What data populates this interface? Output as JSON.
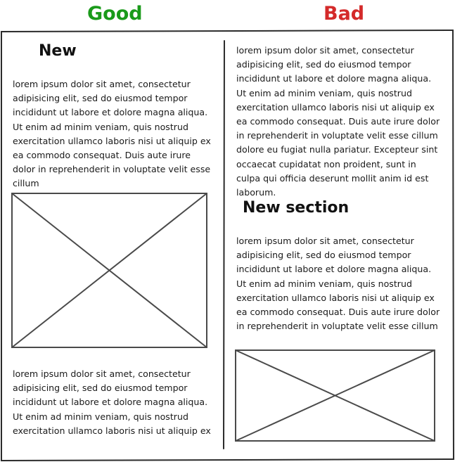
{
  "columns": {
    "good": {
      "title": "Good",
      "color": "#1a9a1a"
    },
    "bad": {
      "title": "Bad",
      "color": "#d42a2a"
    }
  },
  "good": {
    "heading": "New",
    "paragraph_1": "lorem ipsum dolor sit amet, consectetur adipisicing elit, sed do eiusmod tempor incididunt ut labore et dolore magna aliqua. Ut enim ad minim veniam, quis nostrud exercitation ullamco laboris nisi ut aliquip ex ea commodo consequat. Duis aute irure dolor in reprehenderit in voluptate velit esse cillum",
    "paragraph_2": "lorem ipsum dolor sit amet, consectetur adipisicing elit, sed do eiusmod tempor incididunt ut labore et dolore magna aliqua. Ut enim ad minim veniam, quis nostrud exercitation ullamco laboris nisi ut aliquip ex"
  },
  "bad": {
    "paragraph_1": "lorem ipsum dolor sit amet, consectetur adipisicing elit, sed do eiusmod tempor incididunt ut labore et dolore magna aliqua. Ut enim ad minim veniam, quis nostrud exercitation ullamco laboris nisi ut aliquip ex ea commodo consequat. Duis aute irure dolor in reprehenderit in voluptate velit esse cillum dolore eu fugiat nulla pariatur. Excepteur sint occaecat cupidatat non proident, sunt in culpa qui officia deserunt mollit anim id est laborum.",
    "heading": "New section",
    "paragraph_2": "lorem ipsum dolor sit amet, consectetur adipisicing elit, sed do eiusmod tempor incididunt ut labore et dolore magna aliqua. Ut enim ad minim veniam, quis nostrud exercitation ullamco laboris nisi ut aliquip ex ea commodo consequat. Duis aute irure dolor in reprehenderit in voluptate velit esse cillum"
  }
}
